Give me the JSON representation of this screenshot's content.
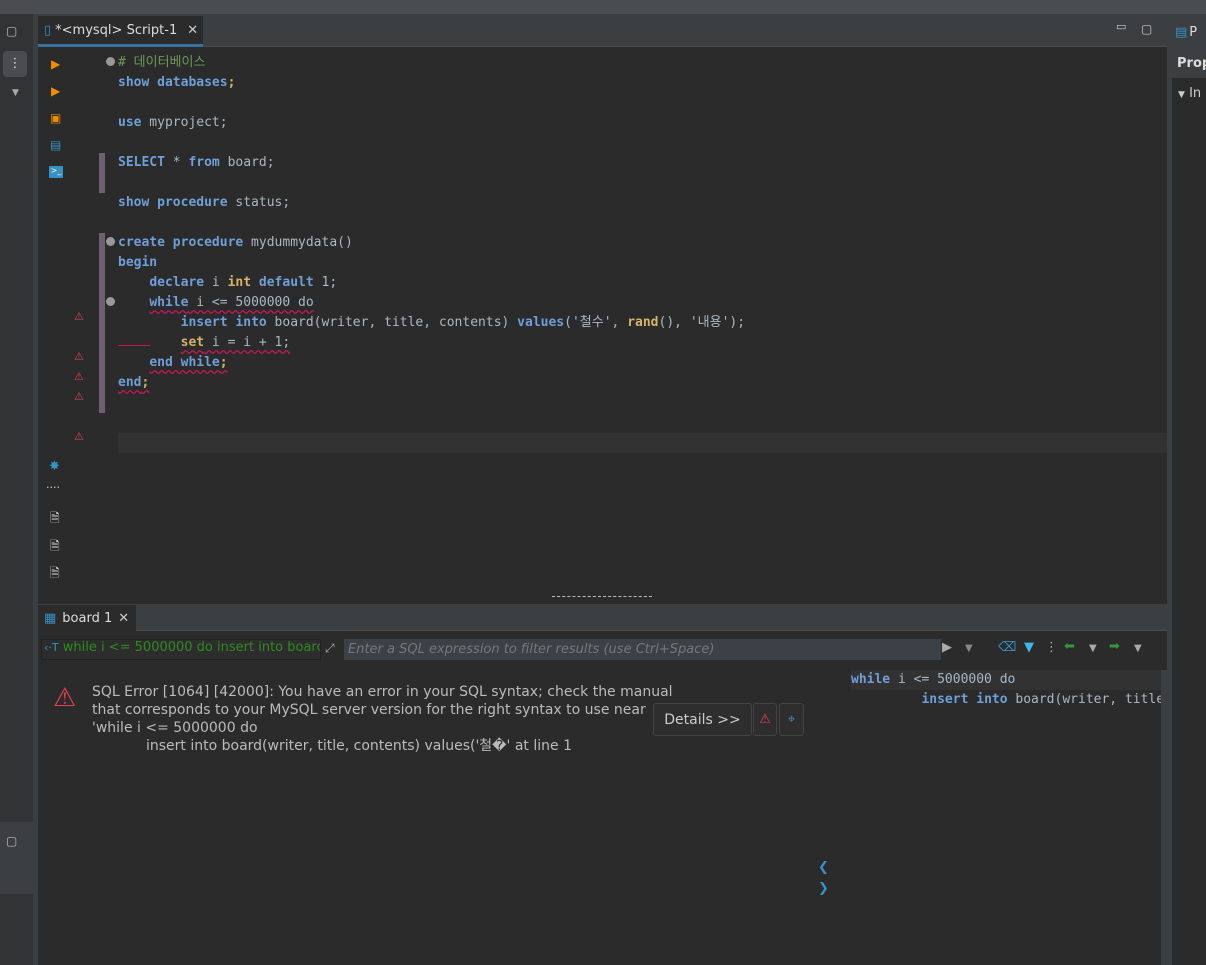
{
  "editor": {
    "tab_title": "*<mysql> Script-1",
    "lines": {
      "l0": "# 데이터베이스",
      "l1a": "show databases",
      "l1b": ";",
      "l2a": "use",
      "l2b": " myproject;",
      "l3a": "SELECT",
      "l3b": " * ",
      "l3c": "from",
      "l3d": " board;",
      "l4a": "show procedure",
      "l4b": " status;",
      "l5a": "create procedure",
      "l5b": " mydummydata()",
      "l6": "begin",
      "l7a": "declare",
      "l7b": " i ",
      "l7c": "int",
      "l7d": " ",
      "l7e": "default",
      "l7f": " 1;",
      "l8a": "while",
      "l8b": " i <= 5000000 do",
      "l9a": "insert into",
      "l9b": " board(writer, title, contents) ",
      "l9c": "values",
      "l9d": "('철수', ",
      "l9e": "rand",
      "l9f": "(), '내용');",
      "l10a": "set",
      "l10b": " i = i + 1;",
      "l11": "end while",
      "l11b": ";",
      "l12": "end",
      "l12b": ";"
    }
  },
  "results": {
    "tab_title": "board 1",
    "query_text": "while i <= 5000000 do insert into boarc",
    "filter_placeholder": "Enter a SQL expression to filter results (use Ctrl+Space)",
    "error_line1": "SQL Error [1064] [42000]: You have an error in your SQL syntax; check the manual",
    "error_line2": "that corresponds to your MySQL server version for the right syntax to use near",
    "error_line3": "'while i <= 5000000 do",
    "error_line4": "insert into board(writer, title, contents) values('철�' at line 1",
    "details_button": "Details >>",
    "sql_preview": {
      "a": "while",
      "b": " i <= 5000000 do",
      "c": "insert into",
      "d": " board(writer, title"
    }
  },
  "right_panel": {
    "tab": "P",
    "header": "Prop",
    "item": "In"
  },
  "colors": {
    "keyword": "#6f9fd8",
    "type": "#d4b36a",
    "comment": "#6a9a5a",
    "error": "#e0404f",
    "accent": "#3592c4"
  }
}
